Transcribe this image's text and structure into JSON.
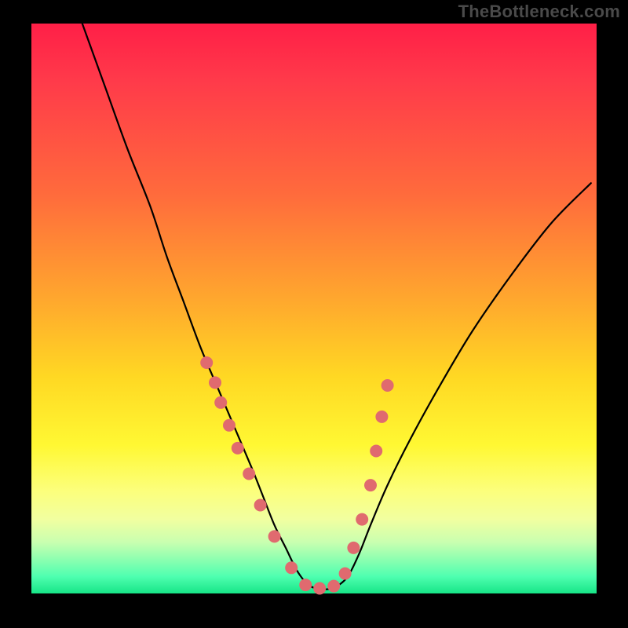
{
  "watermark": "TheBottleneck.com",
  "colors": {
    "background": "#000000",
    "watermark_text": "#4a4a4a",
    "curve": "#000000",
    "points": "#e06a6f",
    "gradient_stops": [
      {
        "offset": 0,
        "color": "#ff1f47"
      },
      {
        "offset": 10,
        "color": "#ff3a4a"
      },
      {
        "offset": 30,
        "color": "#ff6b3c"
      },
      {
        "offset": 48,
        "color": "#ffa62e"
      },
      {
        "offset": 62,
        "color": "#ffd823"
      },
      {
        "offset": 74,
        "color": "#fff833"
      },
      {
        "offset": 82,
        "color": "#fcff7c"
      },
      {
        "offset": 87,
        "color": "#f1ffa0"
      },
      {
        "offset": 91,
        "color": "#c9ffb0"
      },
      {
        "offset": 94,
        "color": "#8dffb0"
      },
      {
        "offset": 97,
        "color": "#4fffb0"
      },
      {
        "offset": 100,
        "color": "#17e587"
      }
    ]
  },
  "chart_data": {
    "type": "line",
    "title": "",
    "xlabel": "",
    "ylabel": "",
    "xlim": [
      0,
      100
    ],
    "ylim": [
      0,
      100
    ],
    "note": "Axes are unlabeled; values are pixel-derived percentages of the plot box. y=0 at bottom.",
    "series": [
      {
        "name": "bottleneck-curve",
        "x": [
          9,
          13,
          17,
          21,
          24,
          27,
          30,
          33,
          36,
          39,
          41,
          43,
          45,
          47,
          49,
          51,
          53,
          54,
          56,
          58,
          60,
          63,
          67,
          72,
          78,
          85,
          92,
          99
        ],
        "y": [
          100,
          89,
          78,
          68,
          59,
          51,
          43,
          36,
          29,
          22,
          17,
          12,
          8,
          4,
          1.5,
          0.8,
          0.8,
          1.2,
          3,
          7,
          12,
          19,
          27,
          36,
          46,
          56,
          65,
          72
        ]
      }
    ],
    "highlighted_points": {
      "name": "overlay-dots",
      "x": [
        31.0,
        32.5,
        33.5,
        35.0,
        36.5,
        38.5,
        40.5,
        43.0,
        46.0,
        48.5,
        51.0,
        53.5,
        55.5,
        57.0,
        58.5,
        60.0,
        61.0,
        62.0,
        63.0
      ],
      "y": [
        40.5,
        37.0,
        33.5,
        29.5,
        25.5,
        21.0,
        15.5,
        10.0,
        4.5,
        1.5,
        0.9,
        1.3,
        3.5,
        8.0,
        13.0,
        19.0,
        25.0,
        31.0,
        36.5
      ]
    }
  }
}
